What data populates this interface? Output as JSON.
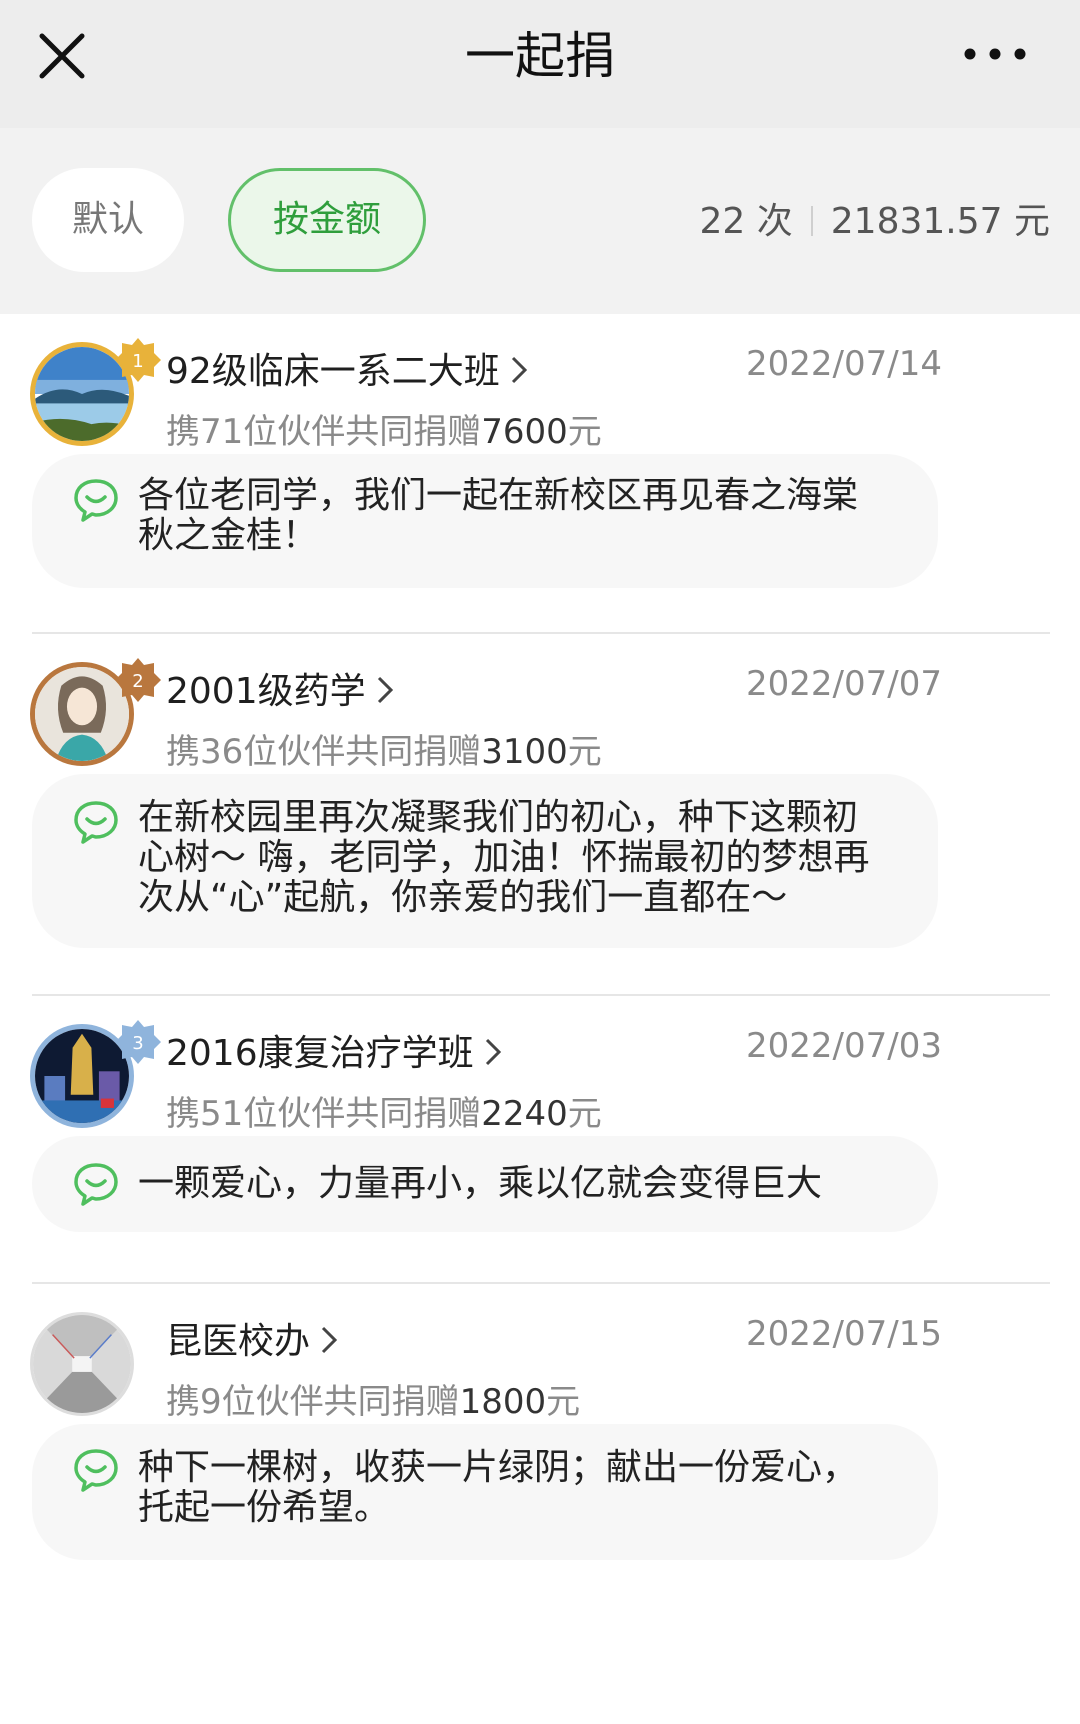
{
  "navbar": {
    "title": "一起捐"
  },
  "filters": {
    "default_label": "默认",
    "amount_label": "按金额"
  },
  "summary": {
    "count": "22 次",
    "total": "21831.57 元"
  },
  "colors": {
    "accent": "#2f9e3c",
    "accent_border": "#62c06a",
    "gold_badge": "#e8b23a",
    "bronze_badge": "#b9773e",
    "silver_badge": "#8fb4dc"
  },
  "entries": [
    {
      "name": "92级临床一系二大班",
      "date": "2022/07/14",
      "sub_prefix": "携71位伙伴共同捐赠",
      "amount": "7600",
      "unit": "元",
      "message_lines": [
        "各位老同学，我们一起在新校区再见春之海棠",
        "秋之金桂！"
      ],
      "rank": "1",
      "avatar": "lake-landscape-avatar"
    },
    {
      "name": "2001级药学",
      "date": "2022/07/07",
      "sub_prefix": "携36位伙伴共同捐赠",
      "amount": "3100",
      "unit": "元",
      "message_lines": [
        "在新校园里再次凝聚我们的初心，种下这颗初",
        "心树～ 嗨，老同学，加油！怀揣最初的梦想再",
        "次从“心”起航，你亲爱的我们一直都在～"
      ],
      "rank": "2",
      "avatar": "illustrated-girl-avatar"
    },
    {
      "name": "2016康复治疗学班",
      "date": "2022/07/03",
      "sub_prefix": "携51位伙伴共同捐赠",
      "amount": "2240",
      "unit": "元",
      "message_lines": [
        "一颗爱心，力量再小，乘以亿就会变得巨大"
      ],
      "rank": "3",
      "avatar": "night-fountain-avatar"
    },
    {
      "name": "昆医校办",
      "date": "2022/07/15",
      "sub_prefix": "携9位伙伴共同捐赠",
      "amount": "1800",
      "unit": "元",
      "message_lines": [
        "种下一棵树，收获一片绿阴；献出一份爱心，",
        "托起一份希望。"
      ],
      "rank": "",
      "avatar": "tunnel-avatar"
    }
  ]
}
